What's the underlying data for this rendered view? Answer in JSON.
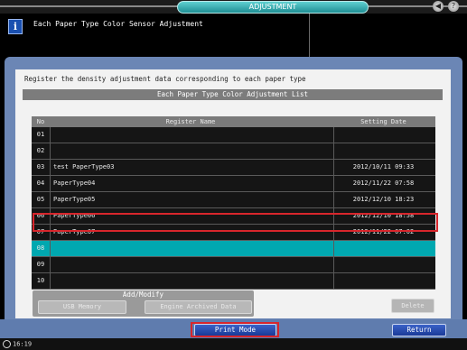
{
  "window": {
    "title": "ADJUSTMENT"
  },
  "header": {
    "title": "Each Paper Type Color Sensor Adjustment",
    "icon": "info-icon"
  },
  "main": {
    "instruction": "Register the density adjustment data corresponding to each paper type",
    "list_title": "Each Paper Type Color Adjustment List",
    "columns": {
      "no": "No",
      "name": "Register Name",
      "date": "Setting Date"
    },
    "rows": [
      {
        "no": "01",
        "name": "",
        "date": ""
      },
      {
        "no": "02",
        "name": "",
        "date": ""
      },
      {
        "no": "03",
        "name": "test PaperType03",
        "date": "2012/10/11 09:33"
      },
      {
        "no": "04",
        "name": "PaperType04",
        "date": "2012/11/22 07:58"
      },
      {
        "no": "05",
        "name": "PaperType05",
        "date": "2012/12/10 18:23"
      },
      {
        "no": "06",
        "name": "PaperType06",
        "date": "2012/12/10 18:58"
      },
      {
        "no": "07",
        "name": "PaperType07",
        "date": "2012/11/22 07:02"
      },
      {
        "no": "08",
        "name": "",
        "date": ""
      },
      {
        "no": "09",
        "name": "",
        "date": ""
      },
      {
        "no": "10",
        "name": "",
        "date": ""
      }
    ],
    "selected_row": "08"
  },
  "add_modify": {
    "label": "Add/Modify",
    "usb_label": "USB Memory",
    "archived_label": "Engine Archived Data"
  },
  "delete_label": "Delete",
  "footer": {
    "print_mode_label": "Print Mode",
    "return_label": "Return",
    "clock": "16:19"
  },
  "colors": {
    "accent": "#00a8b0",
    "highlight": "#d8262c",
    "frame": "#6b86b5"
  }
}
